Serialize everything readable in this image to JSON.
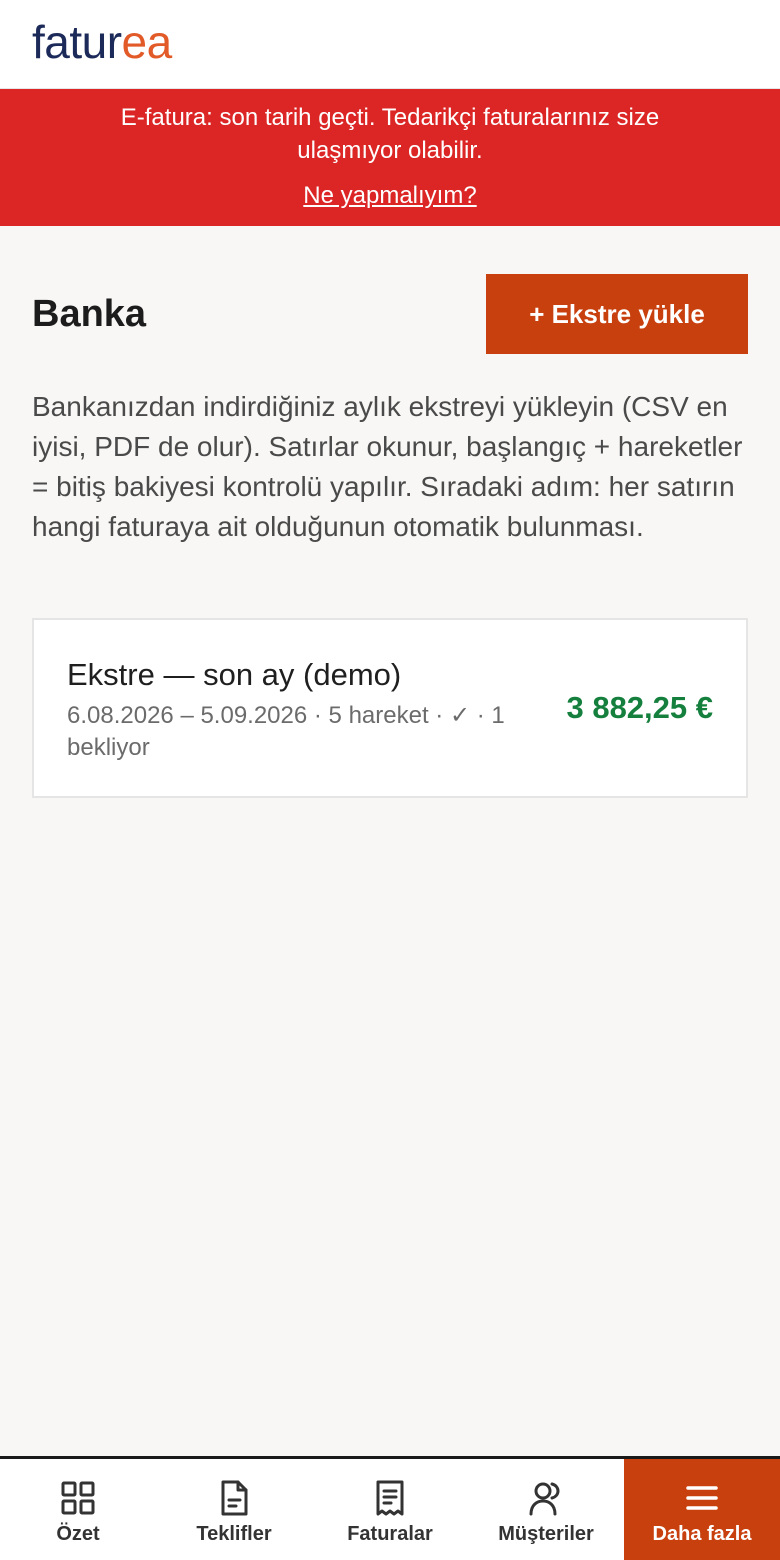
{
  "header": {
    "logo_part1": "fatur",
    "logo_part2": "ea"
  },
  "alert": {
    "message": "E-fatura: son tarih geçti. Tedarikçi faturalarınız size ulaşmıyor olabilir.",
    "link": "Ne yapmalıyım?",
    "color": "#dc2626"
  },
  "main": {
    "title": "Banka",
    "upload_button": "+ Ekstre yükle",
    "description": "Bankanızdan indirdiğiniz aylık ekstreyi yükleyin (CSV en iyisi, PDF de olur). Satırlar okunur, başlangıç + hareketler = bitiş bakiyesi kontrolü yapılır. Sıradaki adım: her satırın hangi faturaya ait olduğunun otomatik bulunması.",
    "statements": [
      {
        "title": "Ekstre — son ay (demo)",
        "subtitle": "6.08.2026 – 5.09.2026 · 5 hareket · ✓ · 1 bekliyor",
        "amount": "3 882,25 €",
        "amount_color": "#15803d"
      }
    ]
  },
  "nav": {
    "items": [
      {
        "label": "Özet",
        "icon": "grid-icon"
      },
      {
        "label": "Teklifler",
        "icon": "document-icon"
      },
      {
        "label": "Faturalar",
        "icon": "receipt-icon"
      },
      {
        "label": "Müşteriler",
        "icon": "users-icon"
      },
      {
        "label": "Daha fazla",
        "icon": "menu-icon",
        "active": true
      }
    ]
  },
  "colors": {
    "accent": "#c9400f",
    "logo_dark": "#1c2a59",
    "logo_orange": "#e25a28"
  }
}
